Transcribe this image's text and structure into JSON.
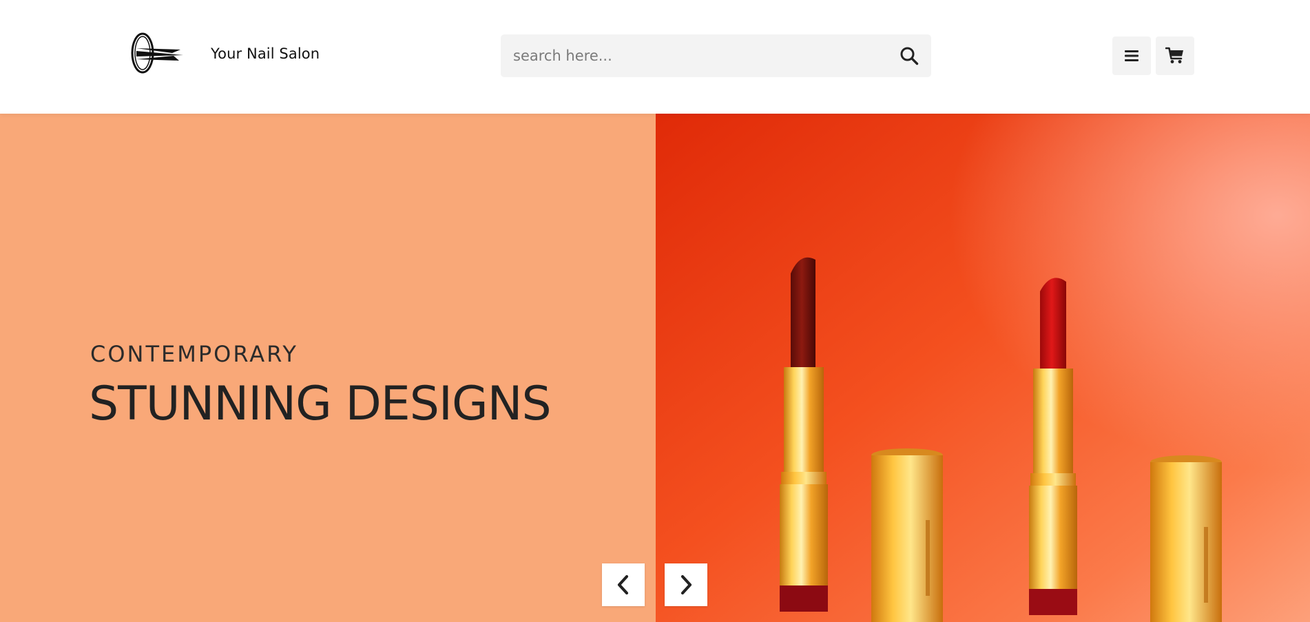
{
  "header": {
    "brand_name": "Your Nail Salon",
    "logo_icon": "scissors-icon",
    "search": {
      "placeholder": "search here...",
      "value": "",
      "icon": "search-icon"
    },
    "menu_icon": "hamburger-menu-icon",
    "cart_icon": "shopping-cart-icon"
  },
  "hero": {
    "kicker": "CONTEMPORARY",
    "headline": "STUNNING DESIGNS",
    "image_subject": "red lipsticks in gold tubes on orange background",
    "prev_icon": "chevron-left-icon",
    "next_icon": "chevron-right-icon",
    "colors": {
      "left_panel": "#f9a878",
      "photo_bg": "#f0552a",
      "text": "#222222"
    }
  }
}
